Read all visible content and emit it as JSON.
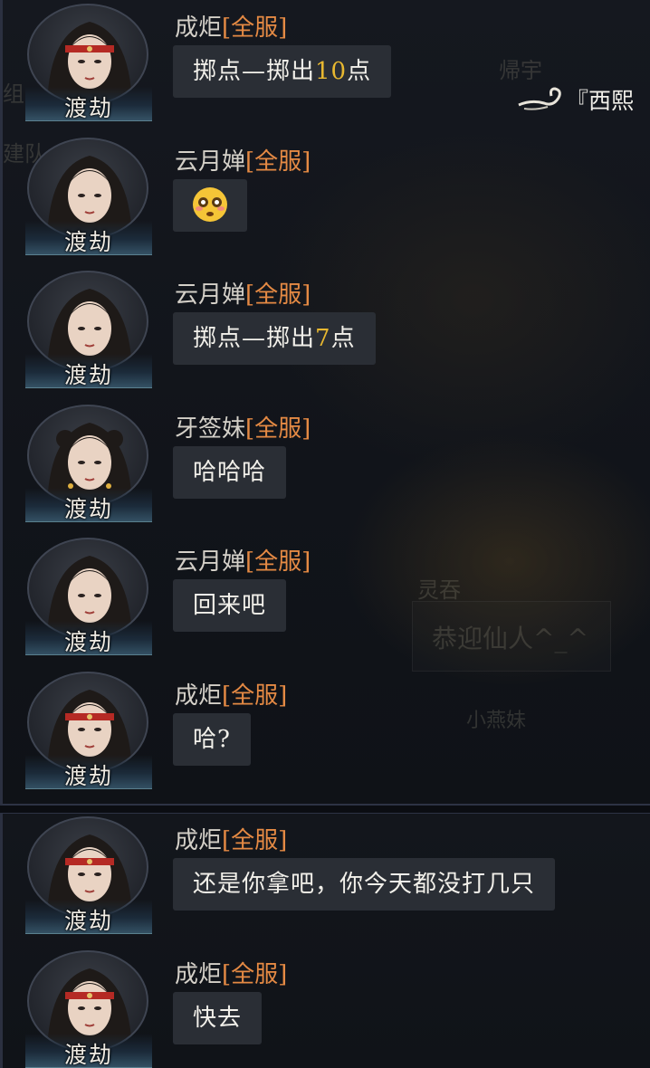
{
  "background": {
    "partial_name": "『西熙",
    "faded_texts": [
      "帰宇",
      "组",
      "建队",
      "灵吞",
      "恭迎仙人^_^",
      "小燕妹"
    ]
  },
  "messages": [
    {
      "name": "成炬",
      "server": "[全服]",
      "title": "渡劫",
      "text_pre": "掷点—掷出",
      "num": "10",
      "text_post": "点"
    },
    {
      "name": "云月婵",
      "server": "[全服]",
      "title": "渡劫",
      "emoji": "flushed-face"
    },
    {
      "name": "云月婵",
      "server": "[全服]",
      "title": "渡劫",
      "text_pre": "掷点—掷出",
      "num": "7",
      "text_post": "点"
    },
    {
      "name": "牙签妹",
      "server": "[全服]",
      "title": "渡劫",
      "text": "哈哈哈"
    },
    {
      "name": "云月婵",
      "server": "[全服]",
      "title": "渡劫",
      "text": "回来吧"
    },
    {
      "name": "成炬",
      "server": "[全服]",
      "title": "渡劫",
      "text": "哈?"
    },
    {
      "name": "成炬",
      "server": "[全服]",
      "title": "渡劫",
      "text": "还是你拿吧，你今天都没打几只"
    },
    {
      "name": "成炬",
      "server": "[全服]",
      "title": "渡劫",
      "text": "快去"
    }
  ],
  "colors": {
    "server_tag": "#e58a44",
    "dice_number": "#e8b830",
    "bubble": "#2a2e35"
  }
}
